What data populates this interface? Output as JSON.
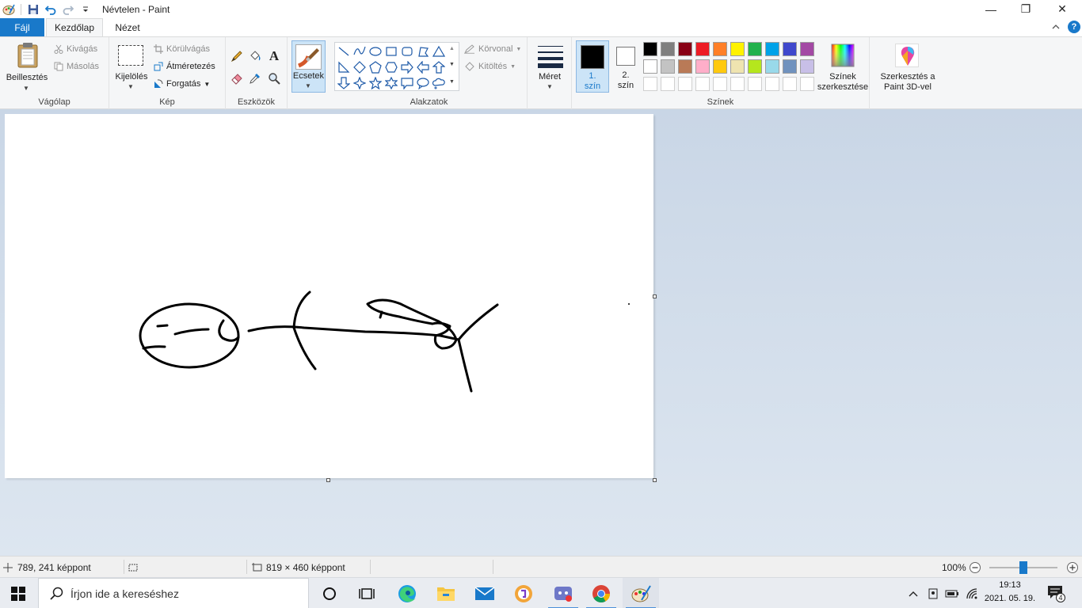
{
  "window": {
    "title": "Névtelen - Paint",
    "minimize": "—",
    "restore": "❐",
    "close": "✕"
  },
  "tabs": {
    "file": "Fájl",
    "home": "Kezdőlap",
    "view": "Nézet"
  },
  "ribbon": {
    "clipboard": {
      "paste": "Beillesztés",
      "cut": "Kivágás",
      "copy": "Másolás",
      "group": "Vágólap"
    },
    "image": {
      "select": "Kijelölés",
      "crop": "Körülvágás",
      "resize": "Átméretezés",
      "rotate": "Forgatás",
      "group": "Kép"
    },
    "tools": {
      "group": "Eszközök"
    },
    "brushes": {
      "label": "Ecsetek"
    },
    "shapes": {
      "outline": "Körvonal",
      "fill": "Kitöltés",
      "group": "Alakzatok"
    },
    "size": {
      "label": "Méret"
    },
    "colors": {
      "color1_line1": "1.",
      "color1_line2": "szín",
      "color2_line1": "2.",
      "color2_line2": "szín",
      "edit_line1": "Színek",
      "edit_line2": "szerkesztése",
      "paint3d_line1": "Szerkesztés a",
      "paint3d_line2": "Paint 3D-vel",
      "group": "Színek",
      "color1_value": "#000000",
      "color2_value": "#ffffff",
      "palette_row1": [
        "#000000",
        "#7f7f7f",
        "#880015",
        "#ed1c24",
        "#ff7f27",
        "#fff200",
        "#22b14c",
        "#00a2e8",
        "#3f48cc",
        "#a349a4"
      ],
      "palette_row2": [
        "#ffffff",
        "#c3c3c3",
        "#b97a57",
        "#ffaec9",
        "#ffc90e",
        "#efe4b0",
        "#b5e61d",
        "#99d9ea",
        "#7092be",
        "#c8bfe7"
      ]
    }
  },
  "status": {
    "cursor_pos": "789, 241 képpont",
    "canvas_size": "819 × 460 képpont",
    "zoom": "100%",
    "zoom_fraction": 0.5
  },
  "taskbar": {
    "search_placeholder": "Írjon ide a kereséshez",
    "time": "19:13",
    "date": "2021. 05. 19.",
    "notifications": "4"
  }
}
